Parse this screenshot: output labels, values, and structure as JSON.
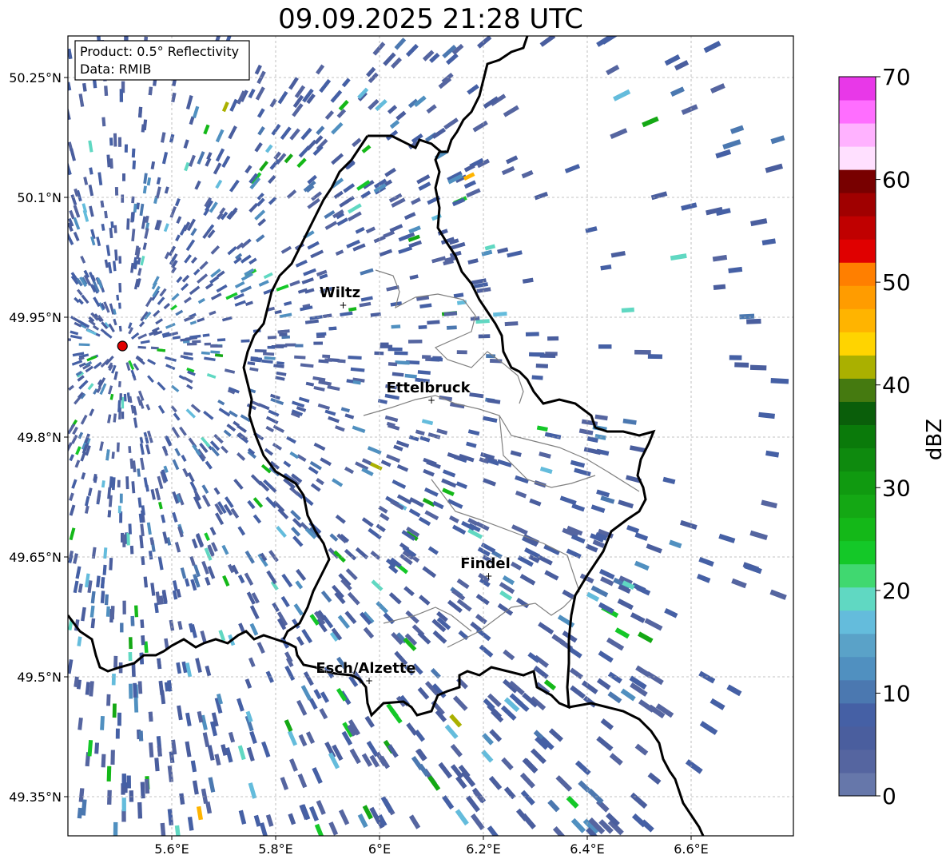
{
  "title": "09.09.2025 21:28 UTC",
  "info_box": {
    "line1": "Product: 0.5° Reflectivity",
    "line2": "Data: RMIB"
  },
  "lat_ticks": [
    "50.25°N",
    "50.1°N",
    "49.95°N",
    "49.8°N",
    "49.65°N",
    "49.5°N",
    "49.35°N"
  ],
  "lon_ticks": [
    "5.6°E",
    "5.8°E",
    "6°E",
    "6.2°E",
    "6.4°E",
    "6.6°E"
  ],
  "cities": [
    {
      "name": "Wiltz",
      "lon": 5.93,
      "lat": 49.966
    },
    {
      "name": "Ettelbruck",
      "lon": 6.1,
      "lat": 49.847
    },
    {
      "name": "Findel",
      "lon": 6.21,
      "lat": 49.627
    },
    {
      "name": "Esch/Alzette",
      "lon": 5.98,
      "lat": 49.496
    }
  ],
  "radar_site": {
    "lon": 5.505,
    "lat": 49.914
  },
  "colorbar": {
    "label": "dBZ",
    "tick_labels": [
      "0",
      "10",
      "20",
      "30",
      "40",
      "50",
      "60",
      "70"
    ],
    "min": 0,
    "max": 70,
    "colors": [
      "#6677aa",
      "#5565a0",
      "#4a5e9e",
      "#4560a5",
      "#4b78b0",
      "#5090c0",
      "#5aa2c8",
      "#64bcdc",
      "#60d8c2",
      "#40d870",
      "#14c828",
      "#14b818",
      "#14a814",
      "#109a10",
      "#0e8a0e",
      "#0a7a0a",
      "#0a5e0a",
      "#457a10",
      "#aab000",
      "#ffd400",
      "#ffb400",
      "#ff9c00",
      "#ff7f00",
      "#e00000",
      "#c00000",
      "#a00000",
      "#780000",
      "#ffe0ff",
      "#ffb2ff",
      "#ff6eff",
      "#e838e8"
    ]
  }
}
